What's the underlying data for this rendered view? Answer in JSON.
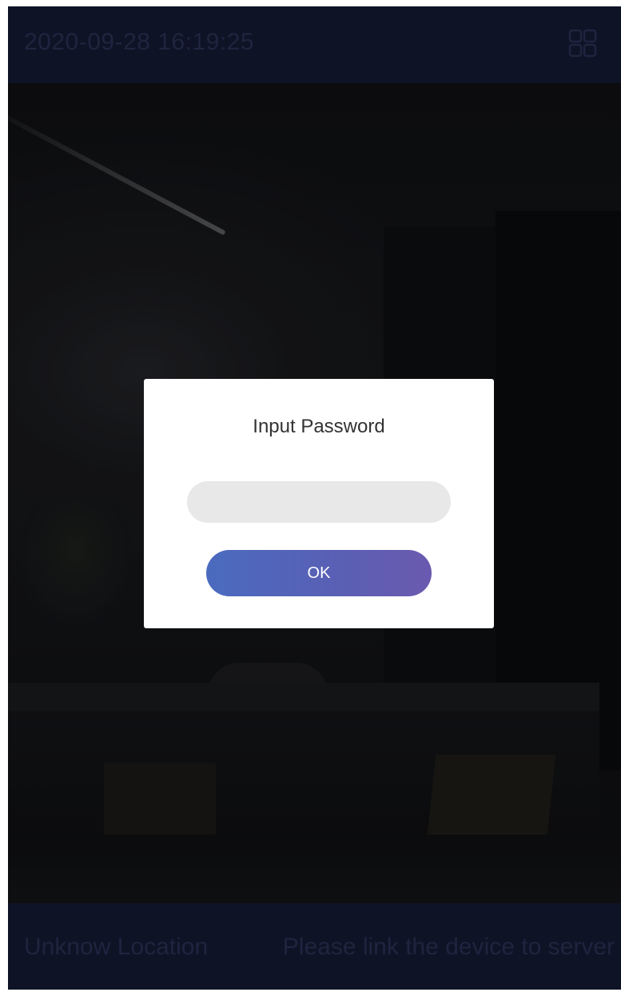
{
  "topbar": {
    "timestamp": "2020-09-28 16:19:25",
    "grid_icon": "grid-layout-icon"
  },
  "bottombar": {
    "location": "Unknow Location",
    "server_message": "Please link the device to server"
  },
  "dialog": {
    "title": "Input Password",
    "password_value": "",
    "ok_label": "OK"
  },
  "colors": {
    "bar_background": "#141a33",
    "bar_text": "#2a3154",
    "button_gradient_start": "#4a6bbf",
    "button_gradient_end": "#6a5aaf",
    "input_background": "#e8e8e8"
  }
}
